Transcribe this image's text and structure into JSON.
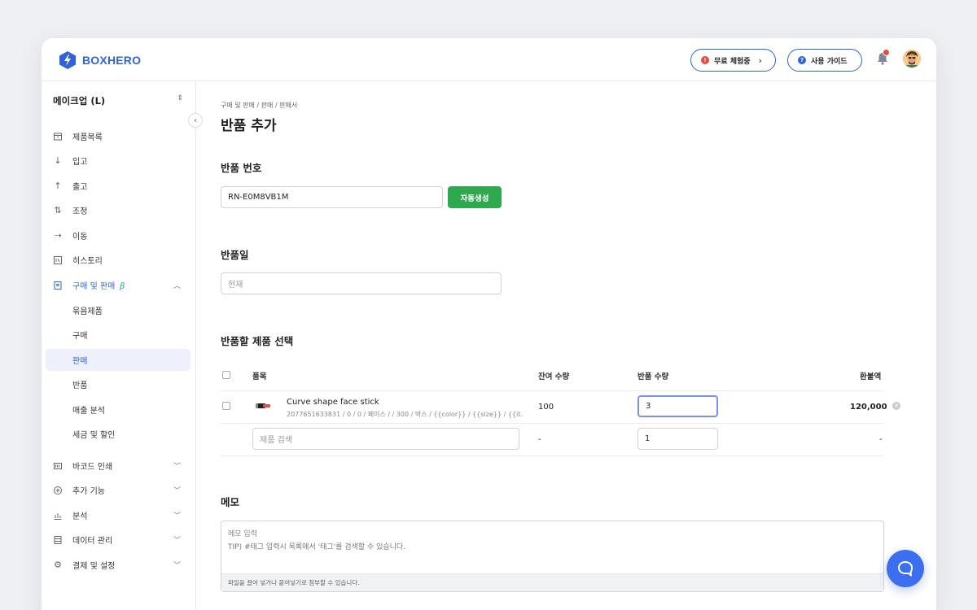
{
  "brand": {
    "name": "BOXHERO",
    "accent": "#2f63d8"
  },
  "header": {
    "trial_label": "무료 체험중",
    "guide_label": "사용 가이드",
    "notification_count": "N"
  },
  "sidebar": {
    "workspace": "메이크업 (L)",
    "items": [
      {
        "label": "제품목록",
        "icon": "box-icon"
      },
      {
        "label": "입고",
        "icon": "arrow-down-icon"
      },
      {
        "label": "출고",
        "icon": "arrow-up-icon"
      },
      {
        "label": "조정",
        "icon": "swap-icon"
      },
      {
        "label": "이동",
        "icon": "move-icon"
      },
      {
        "label": "히스토리",
        "icon": "history-icon"
      },
      {
        "label": "구매 및 판매",
        "icon": "document-icon",
        "badge": "β"
      },
      {
        "label": "묶음제품"
      },
      {
        "label": "구매"
      },
      {
        "label": "판매"
      },
      {
        "label": "반품"
      },
      {
        "label": "매출 분석"
      },
      {
        "label": "세금 및 할인"
      },
      {
        "label": "바코드 인쇄",
        "icon": "barcode-icon"
      },
      {
        "label": "추가 기능",
        "icon": "plus-circle-icon"
      },
      {
        "label": "분석",
        "icon": "chart-icon"
      },
      {
        "label": "데이터 관리",
        "icon": "database-icon"
      },
      {
        "label": "결제 및 설정",
        "icon": "gear-icon"
      }
    ]
  },
  "main": {
    "breadcrumb": "구매 및 판매 / 판매 / 판매서",
    "title": "반품 추가",
    "return_number": {
      "label": "반품 번호",
      "value": "RN-E0M8VB1M",
      "auto_button": "자동생성"
    },
    "return_date": {
      "label": "반품일",
      "placeholder": "현재"
    },
    "products": {
      "label": "반품할 제품 선택",
      "columns": [
        "품목",
        "잔여 수량",
        "반품 수량",
        "환불액"
      ],
      "rows": [
        {
          "name": "Curve shape face stick",
          "detail": "2077651633831 / 0 / 0 / 페이스 / / 300 / 박스 / {{color}} / {{size}} / {{it...",
          "remaining": "100",
          "return_qty": "3",
          "refund": "120,000"
        }
      ],
      "new_row": {
        "search_placeholder": "제품 검색",
        "remaining": "-",
        "return_qty": "1",
        "refund": "-"
      }
    },
    "memo": {
      "label": "메모",
      "placeholder_line1": "메모 입력",
      "placeholder_line2": "TIP) #태그 입력시 목록에서 '태그'를 검색할 수 있습니다.",
      "footer": "파일을 끌어 넣거나 붙여넣기로 첨부할 수 있습니다."
    }
  }
}
